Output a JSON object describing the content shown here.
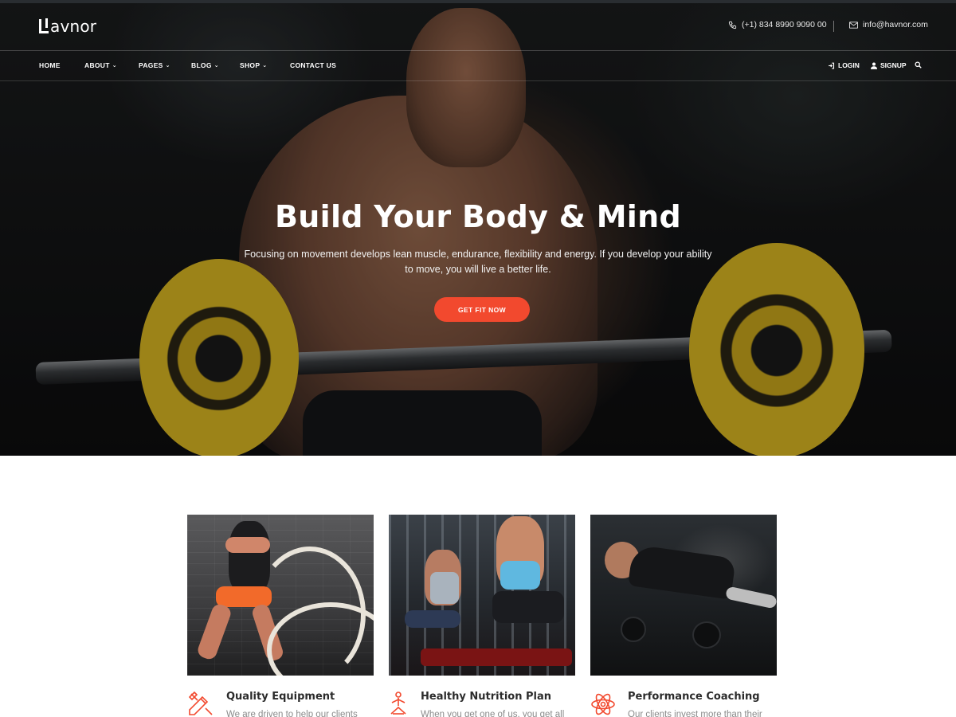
{
  "brand": {
    "name": "avnor"
  },
  "contact": {
    "phone": "(+1) 834 8990 9090 00",
    "email": "info@havnor.com"
  },
  "nav": {
    "items": [
      {
        "label": "HOME",
        "has_dropdown": false
      },
      {
        "label": "ABOUT",
        "has_dropdown": true
      },
      {
        "label": "PAGES",
        "has_dropdown": true
      },
      {
        "label": "BLOG",
        "has_dropdown": true
      },
      {
        "label": "SHOP",
        "has_dropdown": true
      },
      {
        "label": "CONTACT US",
        "has_dropdown": false
      }
    ],
    "login": "LOGIN",
    "signup": "SIGNUP",
    "search_icon": "search-icon",
    "caret_glyph": "⌄"
  },
  "hero": {
    "title": "Build Your Body & Mind",
    "subtitle_line1": "Focusing on movement develops lean muscle, endurance, flexibility and energy. If you develop your ability",
    "subtitle_line2": "to move, you will live a better life.",
    "cta": "GET FIT NOW"
  },
  "features": [
    {
      "title": "Quality Equipment",
      "desc": "We are driven to help our clients",
      "icon": "tools-icon"
    },
    {
      "title": "Healthy Nutrition Plan",
      "desc": "When you get one of us, you get all",
      "icon": "meditation-icon"
    },
    {
      "title": "Performance Coaching",
      "desc": "Our clients invest more than their",
      "icon": "atom-icon"
    }
  ],
  "colors": {
    "accent": "#f2492e",
    "hero_text": "#ffffff",
    "feature_title": "#2b2b2b",
    "feature_desc": "#8a8a8a"
  }
}
